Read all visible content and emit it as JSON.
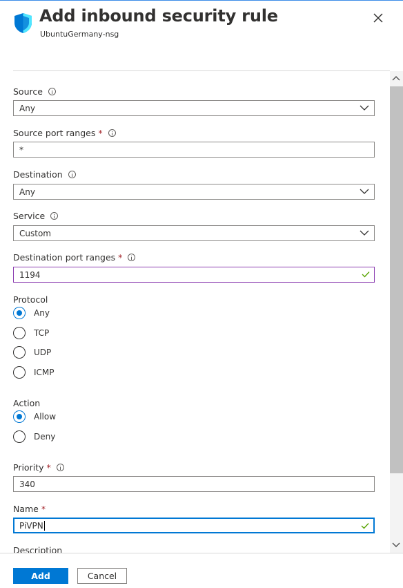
{
  "header": {
    "title": "Add inbound security rule",
    "subtitle": "UbuntuGermany-nsg",
    "close_icon": "close-icon"
  },
  "form": {
    "source": {
      "label": "Source",
      "value": "Any"
    },
    "source_port_ranges": {
      "label": "Source port ranges",
      "required_mark": "*",
      "value": "*"
    },
    "destination": {
      "label": "Destination",
      "value": "Any"
    },
    "service": {
      "label": "Service",
      "value": "Custom"
    },
    "destination_port_ranges": {
      "label": "Destination port ranges",
      "required_mark": "*",
      "value": "1194"
    },
    "protocol": {
      "label": "Protocol",
      "options": [
        "Any",
        "TCP",
        "UDP",
        "ICMP"
      ],
      "selected": "Any"
    },
    "action": {
      "label": "Action",
      "options": [
        "Allow",
        "Deny"
      ],
      "selected": "Allow"
    },
    "priority": {
      "label": "Priority",
      "required_mark": "*",
      "value": "340"
    },
    "name": {
      "label": "Name",
      "required_mark": "*",
      "value": "PiVPN"
    },
    "description": {
      "label": "Description"
    }
  },
  "footer": {
    "add_label": "Add",
    "cancel_label": "Cancel"
  },
  "colors": {
    "accent": "#0078d4",
    "required": "#a4262c",
    "valid_check": "#57a300",
    "focus_purple": "#8a3bb0"
  }
}
